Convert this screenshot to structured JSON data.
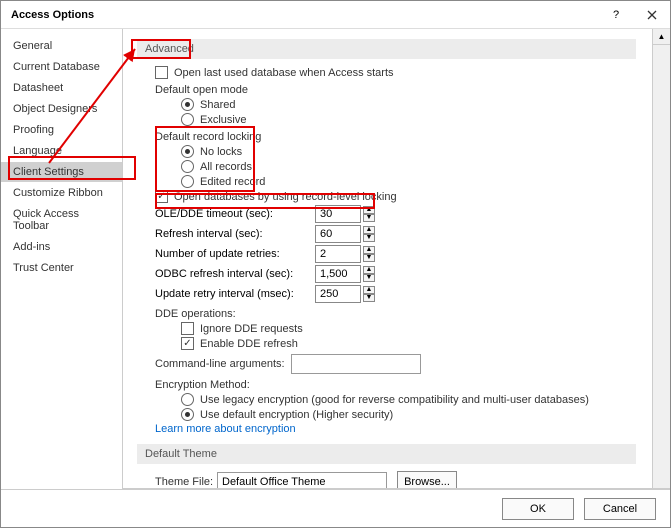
{
  "title": "Access Options",
  "help_glyph": "?",
  "sidebar": {
    "items": [
      "General",
      "Current Database",
      "Datasheet",
      "Object Designers",
      "Proofing",
      "Language",
      "Client Settings",
      "Customize Ribbon",
      "Quick Access Toolbar",
      "Add-ins",
      "Trust Center"
    ],
    "selected_index": 6
  },
  "sections": {
    "advanced_header": "Advanced",
    "open_last": "Open last used database when Access starts",
    "default_open_mode": {
      "title": "Default open mode",
      "shared": "Shared",
      "exclusive": "Exclusive"
    },
    "default_record_locking": {
      "title": "Default record locking",
      "no_locks": "No locks",
      "all_records": "All records",
      "edited_record": "Edited record"
    },
    "open_db_record_level": "Open databases by using record-level locking",
    "ole_dde_timeout": {
      "label": "OLE/DDE timeout (sec):",
      "value": "30"
    },
    "refresh_interval": {
      "label": "Refresh interval (sec):",
      "value": "60"
    },
    "update_retries": {
      "label": "Number of update retries:",
      "value": "2"
    },
    "odbc_refresh": {
      "label": "ODBC refresh interval (sec):",
      "value": "1,500"
    },
    "update_retry_interval": {
      "label": "Update retry interval (msec):",
      "value": "250"
    },
    "dde_ops": {
      "title": "DDE operations:",
      "ignore": "Ignore DDE requests",
      "enable_refresh": "Enable DDE refresh"
    },
    "cmd_line_args_label": "Command-line arguments:",
    "cmd_line_args_value": "",
    "encryption": {
      "title": "Encryption Method:",
      "legacy": "Use legacy encryption (good for reverse compatibility and multi-user databases)",
      "default": "Use default encryption (Higher security)",
      "learn_more": "Learn more about encryption"
    },
    "default_theme_header": "Default Theme",
    "theme_file_label": "Theme File:",
    "theme_file_value": "Default Office Theme",
    "browse_btn": "Browse..."
  },
  "footer": {
    "ok": "OK",
    "cancel": "Cancel"
  }
}
